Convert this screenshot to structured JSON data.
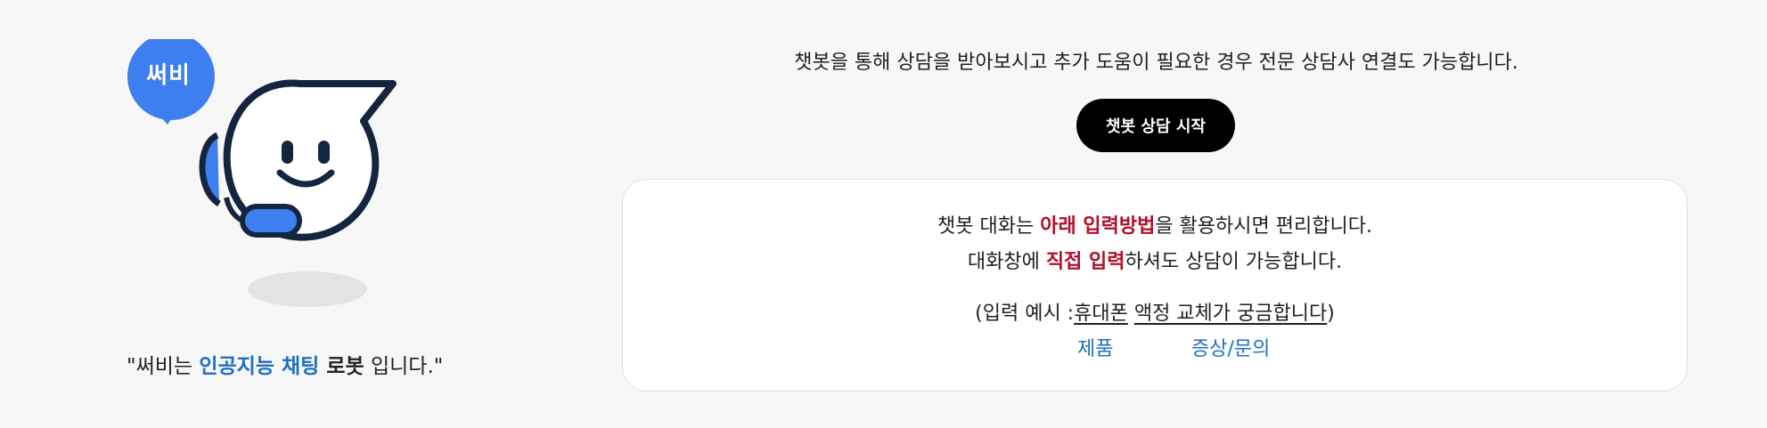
{
  "mascot": {
    "speech_label": "써비",
    "tagline_prefix": "\"써비는 ",
    "tagline_highlight": "인공지능 채팅",
    "tagline_bold": " 로봇",
    "tagline_suffix": " 입니다.\"",
    "colors": {
      "accent": "#3d7ef0",
      "outline": "#14253f",
      "shadow": "#e3e3e3"
    }
  },
  "intro_text": "챗봇을 통해 상담을 받아보시고 추가 도움이 필요한 경우 전문 상담사 연결도 가능합니다.",
  "start_button_label": "챗봇 상담 시작",
  "guide": {
    "line1_prefix": "챗봇 대화는 ",
    "line1_highlight": "아래 입력방법",
    "line1_suffix": "을 활용하시면 편리합니다.",
    "line2_prefix": "대화창에 ",
    "line2_highlight": "직접 입력",
    "line2_suffix": "하셔도 상담이 가능합니다.",
    "example_prefix": "(입력 예시 :",
    "example_word1": "휴대폰",
    "example_word2": "액정 교체가 궁금합니다",
    "example_suffix": ")",
    "options": [
      "제품",
      "증상/문의"
    ],
    "colors": {
      "highlight": "#b0102a",
      "link": "#1f6fc2"
    }
  }
}
